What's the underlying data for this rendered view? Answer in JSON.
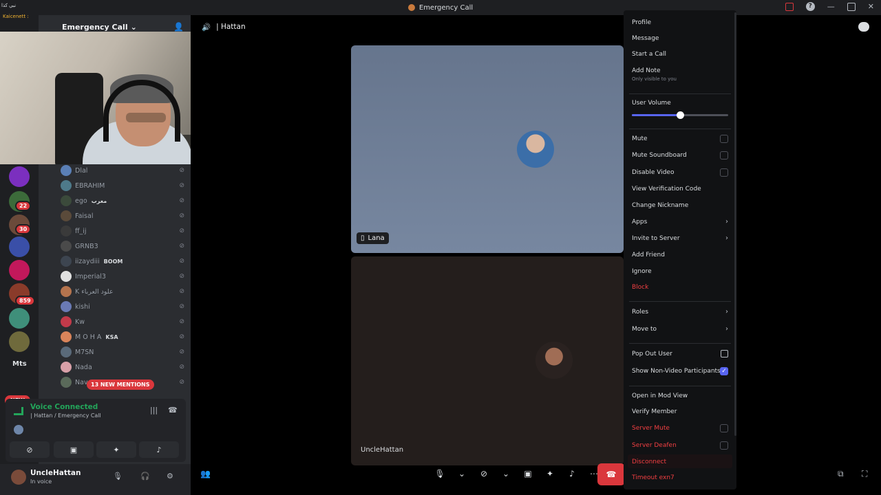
{
  "titlebar": {
    "title": "Emergency Call"
  },
  "overlay": {
    "line1": "نبي كذا",
    "line2": "Kaicenett :"
  },
  "server": {
    "name": "Emergency Call"
  },
  "rail": {
    "badges": [
      "22",
      "30",
      "859"
    ],
    "text_item": "Mts",
    "new_label": "NEW"
  },
  "members": [
    {
      "name": "Dlal",
      "tag": ""
    },
    {
      "name": "EBRAHIM",
      "tag": ""
    },
    {
      "name": "ego",
      "tag": "مغرب"
    },
    {
      "name": "Faisal",
      "tag": ""
    },
    {
      "name": "ff_ij",
      "tag": ""
    },
    {
      "name": "GRNB3",
      "tag": ""
    },
    {
      "name": "iizaydiii",
      "tag": "BOOM"
    },
    {
      "name": "Imperial3",
      "tag": ""
    },
    {
      "name": "K علود العرباء",
      "tag": ""
    },
    {
      "name": "kishi",
      "tag": ""
    },
    {
      "name": "Kw",
      "tag": ""
    },
    {
      "name": "M O H A",
      "tag": "KSA"
    },
    {
      "name": "M7SN",
      "tag": ""
    },
    {
      "name": "Nada",
      "tag": ""
    },
    {
      "name": "Nav",
      "tag": ""
    }
  ],
  "mentions_label": "13 NEW MENTIONS",
  "voice": {
    "status": "Voice Connected",
    "channel": "| Hattan / Emergency Call"
  },
  "user": {
    "name": "UncleHattan",
    "status": "In voice"
  },
  "main": {
    "header_channel": "| Hattan",
    "tile1_name": "Lana",
    "tile2_name": "UncleHattan"
  },
  "menu": {
    "profile": "Profile",
    "message": "Message",
    "start_call": "Start a Call",
    "add_note": "Add Note",
    "add_note_sub": "Only visible to you",
    "user_volume": "User Volume",
    "user_volume_level": 0.5,
    "mute": "Mute",
    "mute_soundboard": "Mute Soundboard",
    "disable_video": "Disable Video",
    "view_verification": "View Verification Code",
    "change_nickname": "Change Nickname",
    "apps": "Apps",
    "invite": "Invite to Server",
    "add_friend": "Add Friend",
    "ignore": "Ignore",
    "block": "Block",
    "roles": "Roles",
    "move_to": "Move to",
    "pop_out": "Pop Out User",
    "show_nonvideo": "Show Non-Video Participants",
    "open_mod": "Open in Mod View",
    "verify_member": "Verify Member",
    "server_mute": "Server Mute",
    "server_deafen": "Server Deafen",
    "disconnect": "Disconnect",
    "timeout": "Timeout exn7"
  },
  "colors": {
    "accent": "#5865f2",
    "danger": "#f23f42",
    "online": "#23a55a"
  }
}
